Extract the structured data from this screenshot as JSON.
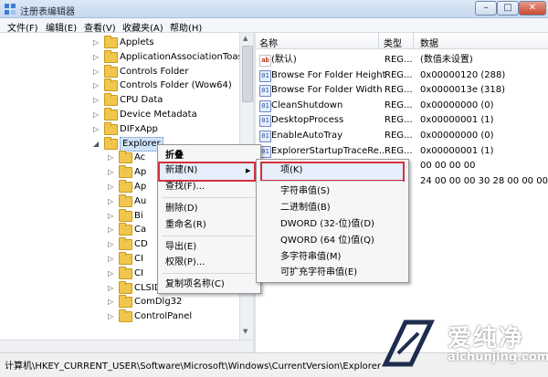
{
  "window": {
    "title": "注册表编辑器",
    "controls": {
      "minimize": "–",
      "maximize": "□",
      "close": "✕"
    }
  },
  "menubar": [
    "文件(F)",
    "编辑(E)",
    "查看(V)",
    "收藏夹(A)",
    "帮助(H)"
  ],
  "tree": {
    "items": [
      {
        "label": "Applets"
      },
      {
        "label": "ApplicationAssociationToasts"
      },
      {
        "label": "Controls Folder"
      },
      {
        "label": "Controls Folder (Wow64)"
      },
      {
        "label": "CPU Data"
      },
      {
        "label": "Device Metadata"
      },
      {
        "label": "DIFxApp"
      },
      {
        "label": "Explorer",
        "expanded": true,
        "selected": true
      },
      {
        "label": "Ac"
      },
      {
        "label": "Ap"
      },
      {
        "label": "Ap"
      },
      {
        "label": "Au"
      },
      {
        "label": "Bi"
      },
      {
        "label": "Ca"
      },
      {
        "label": "CD"
      },
      {
        "label": "CI"
      },
      {
        "label": "CI"
      },
      {
        "label": "CLSID"
      },
      {
        "label": "ComDlg32"
      },
      {
        "label": "ControlPanel"
      }
    ]
  },
  "values": {
    "headers": {
      "name": "名称",
      "type": "类型",
      "data": "数据"
    },
    "rows": [
      {
        "name": "(默认)",
        "type": "REG...",
        "data": "(数值未设置)",
        "icon": "ab"
      },
      {
        "name": "Browse For Folder Height",
        "type": "REG...",
        "data": "0x00000120 (288)",
        "icon": "bin"
      },
      {
        "name": "Browse For Folder Width",
        "type": "REG...",
        "data": "0x0000013e (318)",
        "icon": "bin"
      },
      {
        "name": "CleanShutdown",
        "type": "REG...",
        "data": "0x00000000 (0)",
        "icon": "bin"
      },
      {
        "name": "DesktopProcess",
        "type": "REG...",
        "data": "0x00000001 (1)",
        "icon": "bin"
      },
      {
        "name": "EnableAutoTray",
        "type": "REG...",
        "data": "0x00000000 (0)",
        "icon": "bin"
      },
      {
        "name": "ExplorerStartupTraceRe...",
        "type": "REG...",
        "data": "0x00000001 (1)",
        "icon": "bin"
      },
      {
        "name": "",
        "type": "",
        "data": "00 00 00 00",
        "icon": ""
      },
      {
        "name": "",
        "type": "",
        "data": "24 00 00 00 30 28 00 00 00 00",
        "icon": ""
      }
    ]
  },
  "context_menu": {
    "items": [
      {
        "label": "折叠",
        "bold": true
      },
      {
        "label": "新建(N)",
        "submenu": true,
        "highlighted": true
      },
      {
        "label": "查找(F)..."
      },
      {
        "label": "删除(D)"
      },
      {
        "label": "重命名(R)"
      },
      {
        "label": "导出(E)"
      },
      {
        "label": "权限(P)..."
      },
      {
        "label": "复制项名称(C)"
      }
    ]
  },
  "submenu": {
    "items": [
      {
        "label": "项(K)",
        "highlighted": true
      },
      {
        "label": "字符串值(S)"
      },
      {
        "label": "二进制值(B)"
      },
      {
        "label": "DWORD (32-位)值(D)"
      },
      {
        "label": "QWORD (64 位)值(Q)"
      },
      {
        "label": "多字符串值(M)"
      },
      {
        "label": "可扩充字符串值(E)"
      }
    ]
  },
  "statusbar": {
    "path": "计算机\\HKEY_CURRENT_USER\\Software\\Microsoft\\Windows\\CurrentVersion\\Explorer"
  },
  "watermark": {
    "brand": "爱纯净",
    "url": "aichunjing.com"
  },
  "colors": {
    "highlight_border": "#d2313c",
    "folder": "#f0c64c",
    "titlebar": "#c6d9ee"
  }
}
